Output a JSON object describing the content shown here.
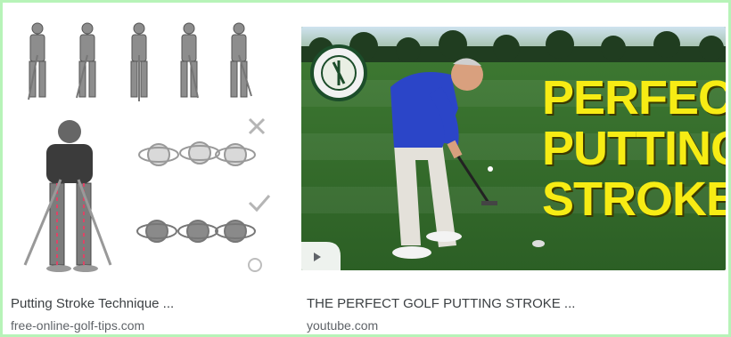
{
  "results": [
    {
      "title": "Putting Stroke Technique ...",
      "source": "free-online-golf-tips.com",
      "image_icon": "golf-putting-diagram"
    },
    {
      "title": "THE PERFECT GOLF PUTTING STROKE ...",
      "source": "youtube.com",
      "image_icon": "golf-putting-video-thumbnail",
      "overlay_text": "PERFECT PUTTING STROKE",
      "play_icon": "play-icon"
    }
  ],
  "colors": {
    "frame_border": "#b7f3b8",
    "headline_yellow": "#f7ec14",
    "grass_green": "#2f6a2a",
    "shirt_blue": "#2b45c8"
  }
}
